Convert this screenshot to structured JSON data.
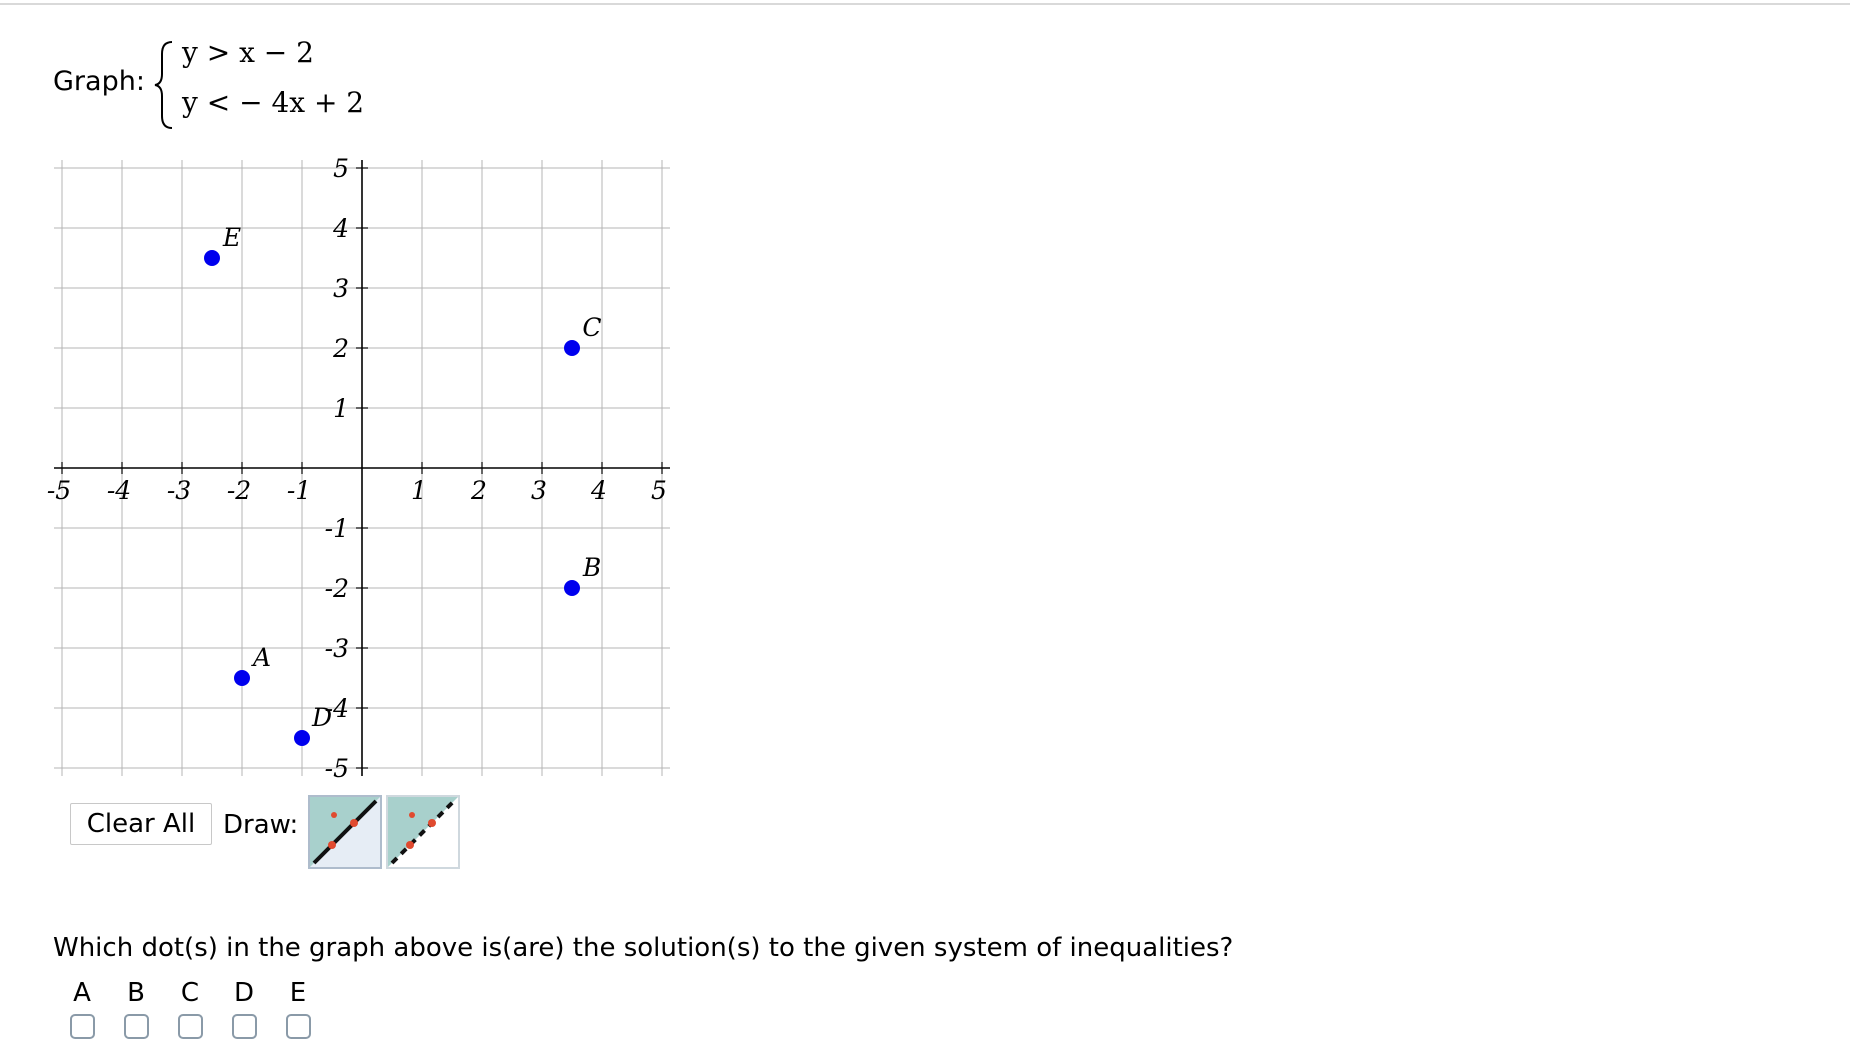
{
  "problem": {
    "label": "Graph:",
    "inequalities": [
      "y > x − 2",
      "y <  − 4x + 2"
    ]
  },
  "graph": {
    "x_range": [
      -5,
      5
    ],
    "y_range": [
      -5,
      5
    ],
    "x_ticks": [
      "-5",
      "-4",
      "-3",
      "-2",
      "-1",
      "1",
      "2",
      "3",
      "4",
      "5"
    ],
    "y_ticks": [
      "5",
      "4",
      "3",
      "2",
      "1",
      "-1",
      "-2",
      "-3",
      "-4",
      "-5"
    ],
    "grid": "1 unit",
    "dot_color": "#0000ee",
    "points": [
      {
        "label": "A",
        "x": -2,
        "y": -3.5
      },
      {
        "label": "B",
        "x": 3.5,
        "y": -2
      },
      {
        "label": "C",
        "x": 3.5,
        "y": 2
      },
      {
        "label": "D",
        "x": -1,
        "y": -4.5
      },
      {
        "label": "E",
        "x": -2.5,
        "y": 3.5
      }
    ]
  },
  "toolbar": {
    "clear_label": "Clear All",
    "draw_label": "Draw:",
    "tools": [
      "solid-line-tool-icon",
      "dashed-line-tool-icon"
    ]
  },
  "question": {
    "text": "Which dot(s) in the graph above is(are) the solution(s) to the given system of inequalities?",
    "choices": [
      "A",
      "B",
      "C",
      "D",
      "E"
    ]
  }
}
